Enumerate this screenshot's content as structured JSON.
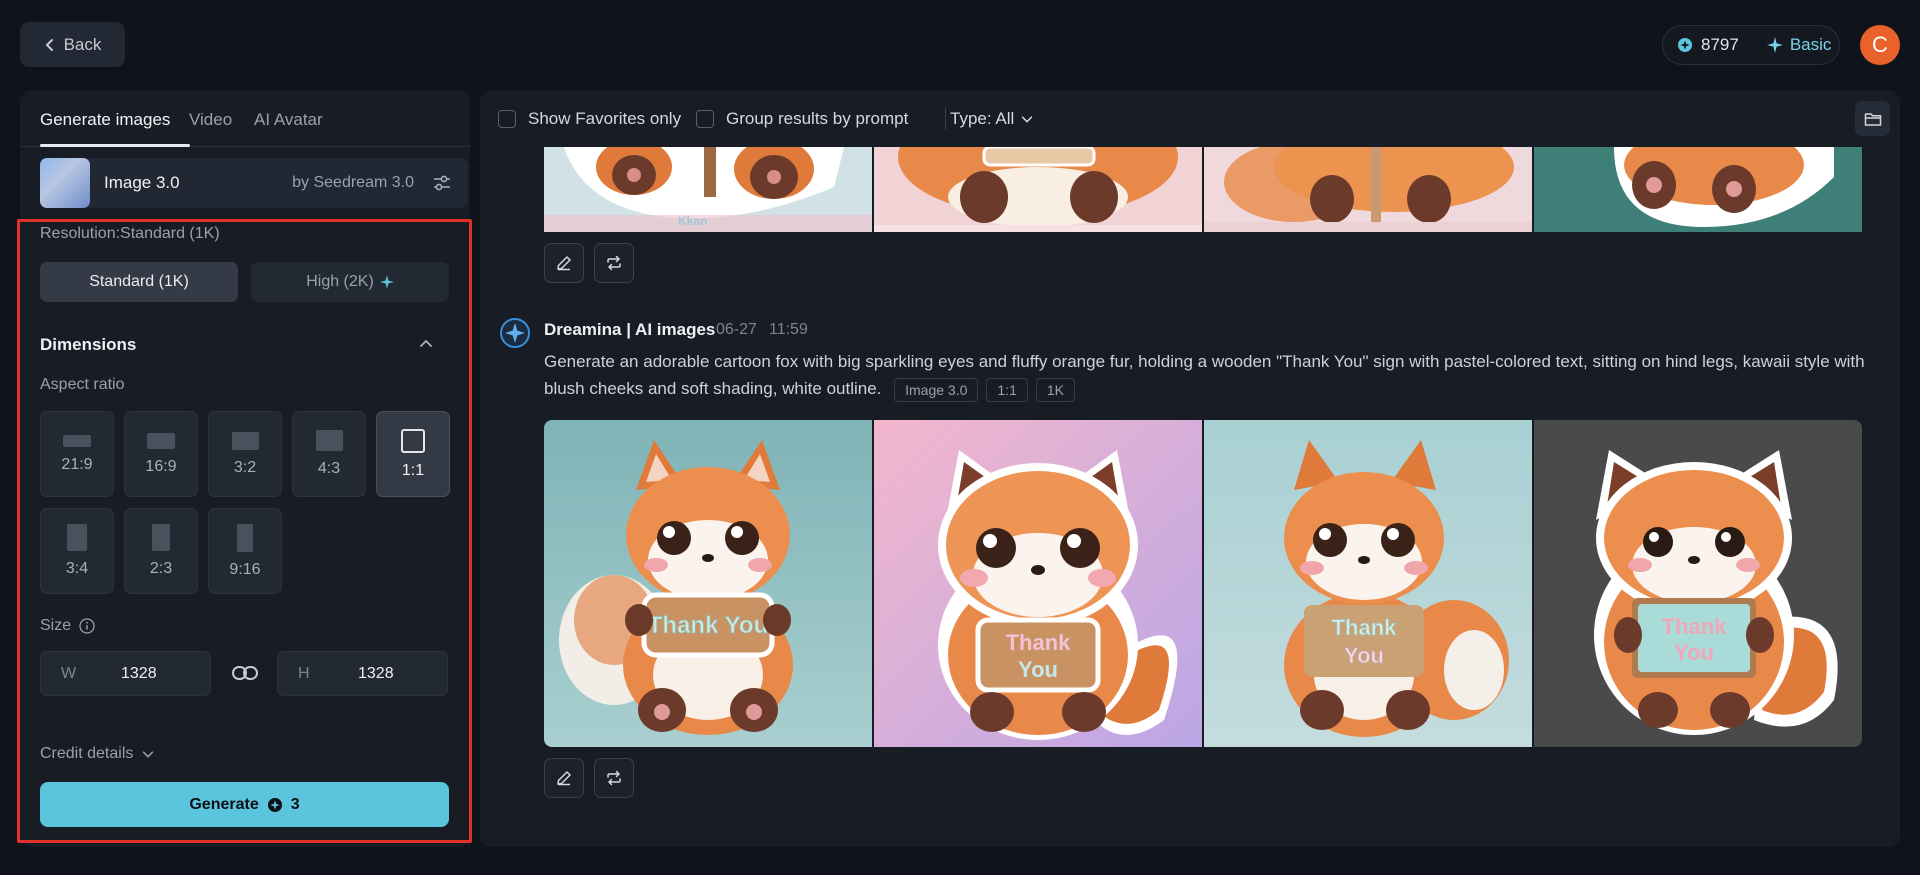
{
  "header": {
    "back_label": "Back",
    "credits": "8797",
    "plan": "Basic",
    "avatar_letter": "C"
  },
  "left_panel": {
    "tabs": [
      {
        "label": "Generate images"
      },
      {
        "label": "Video"
      },
      {
        "label": "AI Avatar"
      }
    ],
    "model": {
      "name": "Image 3.0",
      "by": "by Seedream 3.0"
    },
    "resolution_label": "Resolution:Standard (1K)",
    "resolution_options": [
      {
        "label": "Standard (1K)"
      },
      {
        "label": "High (2K)"
      }
    ],
    "dimensions_title": "Dimensions",
    "aspect_ratio_label": "Aspect ratio",
    "aspect_ratios": [
      {
        "label": "21:9"
      },
      {
        "label": "16:9"
      },
      {
        "label": "3:2"
      },
      {
        "label": "4:3"
      },
      {
        "label": "1:1"
      },
      {
        "label": "3:4"
      },
      {
        "label": "2:3"
      },
      {
        "label": "9:16"
      }
    ],
    "selected_ratio": "1:1",
    "size_label": "Size",
    "width_prefix": "W",
    "width_value": "1328",
    "height_prefix": "H",
    "height_value": "1328",
    "credit_details": "Credit details",
    "generate_label": "Generate",
    "generate_cost": "3"
  },
  "right_panel": {
    "filters": {
      "favorites_label": "Show Favorites only",
      "group_label": "Group results by prompt",
      "type_label": "Type: All"
    },
    "result": {
      "author": "Dreamina | AI images",
      "date": "06-27",
      "time": "11:59",
      "prompt": "Generate an adorable cartoon fox with big sparkling eyes and fluffy orange fur, holding a wooden \"Thank You\" sign with pastel-colored text, sitting on hind legs, kawaii style with blush cheeks and soft shading, white outline.",
      "tags": [
        "Image 3.0",
        "1:1",
        "1K"
      ],
      "sign_text_a": "Thank You",
      "sign_text_b": "Thank",
      "sign_text_c": "You"
    },
    "partial_sign_text": "Kkan"
  },
  "colors": {
    "accent": "#5ac5dc",
    "highlight_border": "#e0322b",
    "avatar": "#e9612b"
  }
}
